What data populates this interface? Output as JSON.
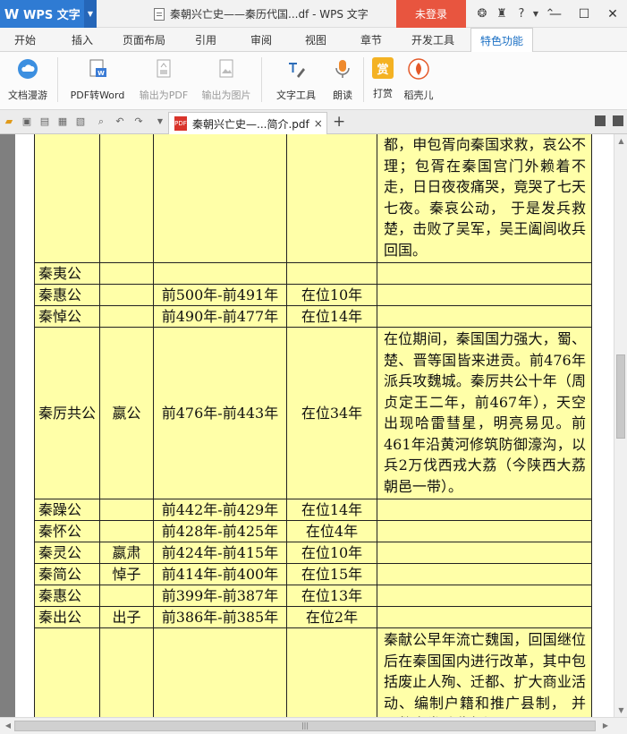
{
  "titlebar": {
    "app_name": "WPS 文字",
    "app_logo": "W",
    "doc_title": "秦朝兴亡史——秦历代国...df - WPS 文字",
    "login_label": "未登录",
    "icons": [
      "skin-icon",
      "shirt-icon",
      "help-icon",
      "collapse-icon"
    ],
    "help_glyph": "?"
  },
  "menu": {
    "tabs": [
      "开始",
      "插入",
      "页面布局",
      "引用",
      "审阅",
      "视图",
      "章节",
      "开发工具",
      "特色功能"
    ],
    "active": "特色功能"
  },
  "ribbon": {
    "items": [
      {
        "label": "文档漫游",
        "icon": "cloud-icon",
        "enabled": true
      },
      {
        "label": "PDF转Word",
        "icon": "pdf-to-word-icon",
        "enabled": true
      },
      {
        "label": "输出为PDF",
        "icon": "export-pdf-icon",
        "enabled": false
      },
      {
        "label": "输出为图片",
        "icon": "export-image-icon",
        "enabled": false
      },
      {
        "label": "文字工具",
        "icon": "text-tools-icon",
        "enabled": true
      },
      {
        "label": "朗读",
        "icon": "microphone-icon",
        "enabled": true
      },
      {
        "label": "打赏",
        "icon": "reward-icon",
        "glyph": "赏",
        "enabled": true
      },
      {
        "label": "稻壳儿",
        "icon": "docer-icon",
        "enabled": true
      }
    ]
  },
  "doc_tab": {
    "label": "秦朝兴亡史—...简介.pdf",
    "close": "×",
    "pdf_badge": "PDF",
    "new_tab": "+"
  },
  "table": {
    "rows": [
      {
        "name": "",
        "given": "",
        "years": "",
        "reign": "",
        "note": "都，申包胥向秦国求救，哀公不理；包胥在秦国宫门外赖着不走，日日夜夜痛哭，竟哭了七天七夜。秦哀公动， 于是发兵救楚，击败了吴军，吴王阖闾收兵回国。"
      },
      {
        "name": "秦夷公",
        "given": "",
        "years": "",
        "reign": "",
        "note": ""
      },
      {
        "name": "秦惠公",
        "given": "",
        "years": "前500年-前491年",
        "reign": "在位10年",
        "note": ""
      },
      {
        "name": "秦悼公",
        "given": "",
        "years": "前490年-前477年",
        "reign": "在位14年",
        "note": ""
      },
      {
        "name": "秦厉共公",
        "given": "嬴公",
        "years": "前476年-前443年",
        "reign": "在位34年",
        "note": "在位期间，秦国国力强大，蜀、楚、晋等国皆来进贡。前476年派兵攻魏城。秦厉共公十年（周贞定王二年，前467年），天空出现哈雷彗星，明亮易见。前461年沿黄河修筑防御濠沟，以兵2万伐西戎大荔（今陕西大荔朝邑一带）。"
      },
      {
        "name": "秦躁公",
        "given": "",
        "years": "前442年-前429年",
        "reign": "在位14年",
        "note": ""
      },
      {
        "name": "秦怀公",
        "given": "",
        "years": "前428年-前425年",
        "reign": "在位4年",
        "note": ""
      },
      {
        "name": "秦灵公",
        "given": "嬴肃",
        "years": "前424年-前415年",
        "reign": "在位10年",
        "note": ""
      },
      {
        "name": "秦简公",
        "given": "悼子",
        "years": "前414年-前400年",
        "reign": "在位15年",
        "note": ""
      },
      {
        "name": "秦惠公",
        "given": "",
        "years": "前399年-前387年",
        "reign": "在位13年",
        "note": ""
      },
      {
        "name": "秦出公",
        "given": "出子",
        "years": "前386年-前385年",
        "reign": "在位2年",
        "note": ""
      },
      {
        "name": "",
        "given": "",
        "years": "",
        "reign": "",
        "note": "秦献公早年流亡魏国，回国继位后在秦国国内进行改革，其中包括废止人殉、迁都、扩大商业活动、编制户籍和推广县制， 并且数次发动收复河西"
      }
    ]
  },
  "colors": {
    "app_blue": "#2f7bd3",
    "login_red": "#e8553f",
    "active_tab": "#1a6fc4",
    "cell_fill": "#ffffa8",
    "page_bg": "#7f7f7f"
  }
}
